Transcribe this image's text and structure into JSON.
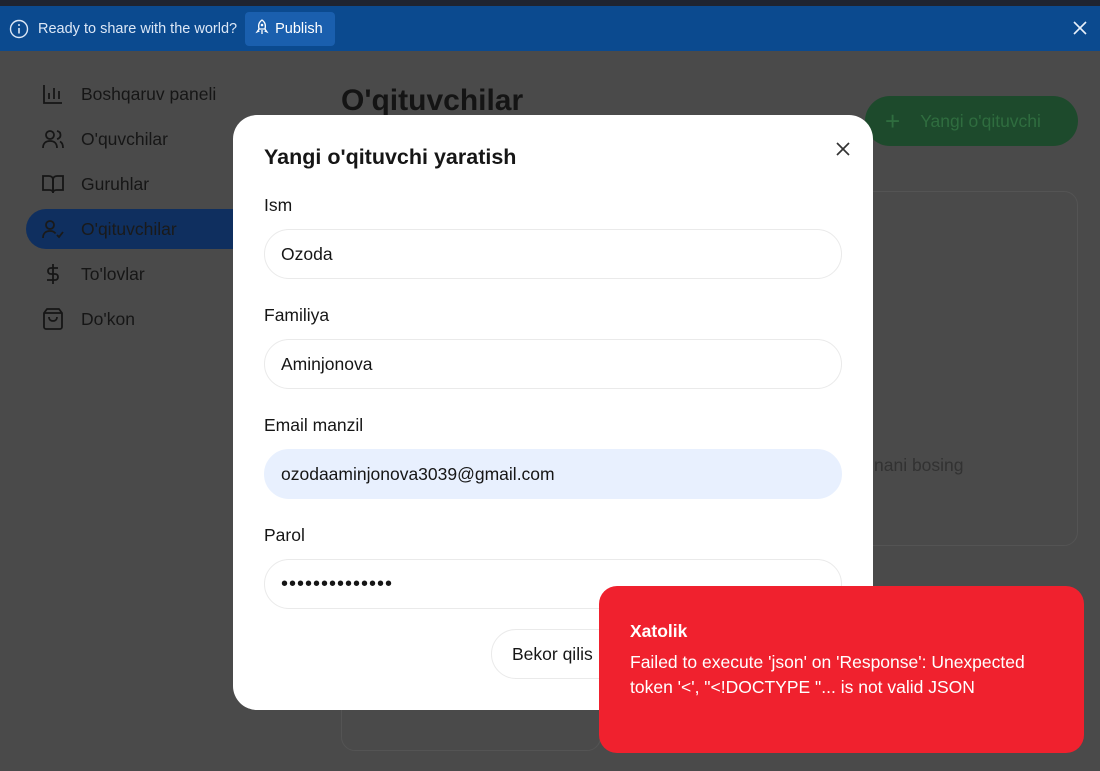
{
  "banner": {
    "text": "Ready to share with the world?",
    "publish_label": "Publish"
  },
  "sidebar": {
    "items": [
      {
        "label": "Boshqaruv paneli",
        "icon": "bar-chart-icon"
      },
      {
        "label": "O'quvchilar",
        "icon": "users-icon"
      },
      {
        "label": "Guruhlar",
        "icon": "book-open-icon"
      },
      {
        "label": "O'qituvchilar",
        "icon": "user-check-icon",
        "active": true
      },
      {
        "label": "To'lovlar",
        "icon": "dollar-icon"
      },
      {
        "label": "Do'kon",
        "icon": "shopping-bag-icon"
      }
    ]
  },
  "main": {
    "title": "O'qituvchilar",
    "new_button_label": "Yangi o'qituvchi",
    "empty_hint": "nani bosing"
  },
  "modal": {
    "title": "Yangi o'qituvchi yaratish",
    "fields": {
      "first_name": {
        "label": "Ism",
        "value": "Ozoda"
      },
      "last_name": {
        "label": "Familiya",
        "value": "Aminjonova"
      },
      "email": {
        "label": "Email manzil",
        "value": "ozodaaminjonova3039@gmail.com"
      },
      "password": {
        "label": "Parol",
        "value": "••••••••••••••"
      }
    },
    "cancel_label": "Bekor qilis"
  },
  "toast": {
    "title": "Xatolik",
    "message": "Failed to execute 'json' on 'Response': Unexpected token '<', \"<!DOCTYPE \"... is not valid JSON"
  },
  "colors": {
    "banner_bg": "#0b4a8f",
    "toast_bg": "#f0212e",
    "active_item_bg": "#0f2f5f",
    "primary_green": "#1d4a2c",
    "autofill_bg": "#e8f0fe"
  }
}
